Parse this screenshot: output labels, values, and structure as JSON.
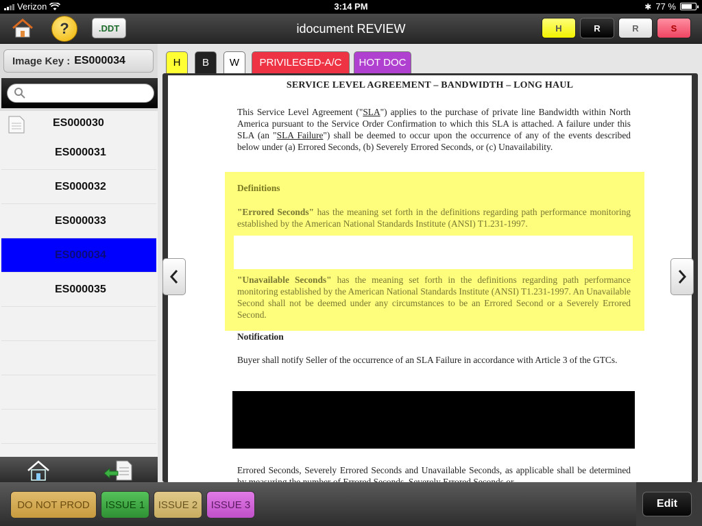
{
  "status_bar": {
    "carrier": "Verizon",
    "time": "3:14 PM",
    "battery": "77 %",
    "battery_level": 0.77
  },
  "nav": {
    "title": "idocument REVIEW",
    "help_label": "?",
    "ddt_label": ".DDT",
    "buttons": {
      "h": "H",
      "r": "R",
      "r2": "R",
      "s": "S"
    }
  },
  "sidebar": {
    "image_key_label": "Image Key :",
    "image_key_value": "ES000034",
    "search_placeholder": "",
    "docs": [
      "ES000030",
      "ES000031",
      "ES000032",
      "ES000033",
      "ES000034",
      "ES000035"
    ],
    "selected_index": 4
  },
  "tabs": {
    "h": "H",
    "b": "B",
    "w": "W",
    "privileged": "PRIVILEGED-A/C",
    "hot": "HOT DOC"
  },
  "document": {
    "title": "SERVICE LEVEL AGREEMENT – BANDWIDTH – LONG HAUL",
    "intro_a": "This Service Level Agreement (\"",
    "intro_sla": "SLA",
    "intro_b": "\") applies to the purchase of private line Bandwidth within North America pursuant to the Service Order Confirmation to which this SLA is attached. A failure under this SLA (an \"",
    "intro_sla_failure": "SLA Failure",
    "intro_c": "\") shall be deemed to occur upon the occurrence of any of the events described below under (a) Errored Seconds, (b) Severely Errored Seconds, or (c) Unavailability.",
    "definitions_heading": "Definitions",
    "errored_term": "\"Errored Seconds\"",
    "errored_text": " has the meaning set forth in the definitions regarding path performance monitoring established by the American National Standards Institute (ANSI) T1.231-1997.",
    "unavail_term": "\"Unavailable Seconds\"",
    "unavail_text": " has the meaning set forth in the definitions regarding path performance monitoring established by the American National Standards Institute (ANSI) T1.231-1997.  An Unavailable Second shall not be deemed under any circumstances to be an Errored Second or a Severely Errored Second.",
    "notification_heading": "Notification",
    "notification_text": "Buyer shall notify Seller of the occurrence of an SLA Failure in accordance with Article 3 of the GTCs.",
    "errored2_text": "Errored Seconds, Severely Errored Seconds and Unavailable Seconds, as applicable shall be determined by measuring the number of Errored Seconds, Severely Errored Seconds or"
  },
  "bottom": {
    "do_not_prod": "DO NOT PROD",
    "issue1": "ISSUE 1",
    "issue2": "ISSUE 2",
    "issue3": "ISSUE 3",
    "edit": "Edit"
  }
}
